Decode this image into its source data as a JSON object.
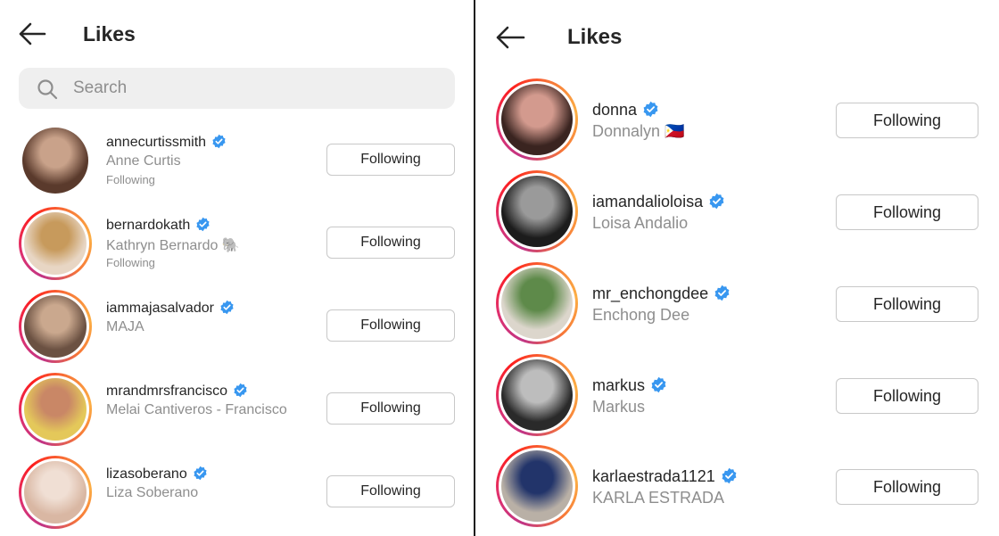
{
  "left": {
    "title": "Likes",
    "search": {
      "placeholder": "Search"
    },
    "users": [
      {
        "username": "annecurtissmith",
        "name": "Anne Curtis",
        "sub": "Following",
        "button": "Following",
        "story_ring": false,
        "colors": [
          "#5a3a2c",
          "#c9a28a"
        ]
      },
      {
        "username": "bernardokath",
        "name": "Kathryn Bernardo 🐘",
        "sub": "Following",
        "button": "Following",
        "story_ring": true,
        "colors": [
          "#e8d6c4",
          "#c79a5c"
        ]
      },
      {
        "username": "iammajasalvador",
        "name": "MAJA",
        "sub": "",
        "button": "Following",
        "story_ring": true,
        "colors": [
          "#6b5142",
          "#caa88e"
        ]
      },
      {
        "username": "mrandmrsfrancisco",
        "name": "Melai Cantiveros - Francisco",
        "sub": "",
        "button": "Following",
        "story_ring": true,
        "colors": [
          "#e4c85a",
          "#c98766"
        ]
      },
      {
        "username": "lizasoberano",
        "name": "Liza Soberano",
        "sub": "",
        "button": "Following",
        "story_ring": true,
        "colors": [
          "#d9b7a3",
          "#f0dfd4"
        ]
      }
    ]
  },
  "right": {
    "title": "Likes",
    "users": [
      {
        "username": "donna",
        "name": "Donnalyn 🇵🇭",
        "button": "Following",
        "colors": [
          "#3a2420",
          "#d39a8e"
        ]
      },
      {
        "username": "iamandalioloisa",
        "name": "Loisa Andalio",
        "button": "Following",
        "colors": [
          "#1c1c1c",
          "#9a9a9a"
        ]
      },
      {
        "username": "mr_enchongdee",
        "name": "Enchong Dee",
        "button": "Following",
        "colors": [
          "#dcd6cc",
          "#5e8a4a"
        ]
      },
      {
        "username": "markus",
        "name": "Markus",
        "button": "Following",
        "colors": [
          "#2a2a2a",
          "#bdbdbd"
        ]
      },
      {
        "username": "karlaestrada1121",
        "name": "KARLA ESTRADA",
        "button": "Following",
        "colors": [
          "#b9b0a6",
          "#22346a"
        ]
      }
    ]
  },
  "colors": {
    "verified": "#3897f0",
    "muted": "#8e8e8e",
    "text": "#262626"
  },
  "icons": {
    "back": "arrow-left-icon",
    "search": "search-icon",
    "verified": "verified-badge-icon"
  }
}
